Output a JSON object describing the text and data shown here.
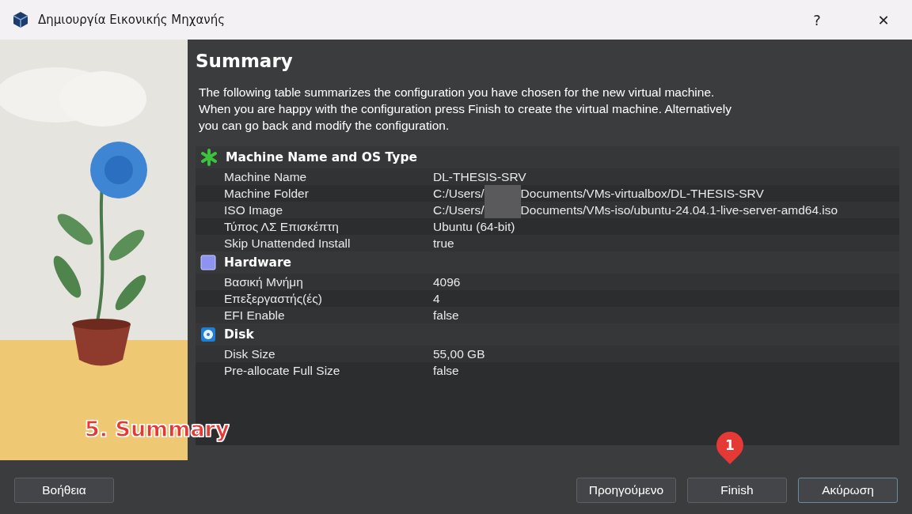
{
  "window": {
    "title": "Δημιουργία Εικονικής Μηχανής",
    "help": "?",
    "close": "✕"
  },
  "page": {
    "title": "Summary",
    "description": "The following table summarizes the configuration you have chosen for the new virtual machine.\nWhen you are happy with the configuration press Finish to create the virtual machine. Alternatively\nyou can go back and modify the configuration."
  },
  "sections": [
    {
      "title": "Machine Name and OS Type",
      "kind": "machine",
      "rows": [
        {
          "label": "Machine Name",
          "value": "DL-THESIS-SRV",
          "kind": "plain"
        },
        {
          "label": "Machine Folder",
          "value": "C:/Users/",
          "value_after": "Documents/VMs-virtualbox/DL-THESIS-SRV",
          "kind": "redacted"
        },
        {
          "label": "ISO Image",
          "value": "C:/Users/",
          "value_after": "Documents/VMs-iso/ubuntu-24.04.1-live-server-amd64.iso",
          "kind": "redacted"
        },
        {
          "label": "Τύπος ΛΣ Επισκέπτη",
          "value": "Ubuntu (64-bit)",
          "kind": "plain"
        },
        {
          "label": "Skip Unattended Install",
          "value": "true",
          "kind": "plain"
        }
      ]
    },
    {
      "title": "Hardware",
      "kind": "hardware",
      "rows": [
        {
          "label": "Βασική Μνήμη",
          "value": "4096",
          "kind": "plain"
        },
        {
          "label": "Επεξεργαστής(ές)",
          "value": "4",
          "kind": "plain"
        },
        {
          "label": "EFI Enable",
          "value": "false",
          "kind": "plain"
        }
      ]
    },
    {
      "title": "Disk",
      "kind": "disk",
      "rows": [
        {
          "label": "Disk Size",
          "value": "55,00 GB",
          "kind": "plain"
        },
        {
          "label": "Pre-allocate Full Size",
          "value": "false",
          "kind": "plain"
        }
      ]
    }
  ],
  "buttons": {
    "help": "Βοήθεια",
    "back": "Προηγούμενο",
    "finish": "Finish",
    "cancel": "Ακύρωση"
  },
  "annotations": {
    "step_label": "5. Summary",
    "marker": "1"
  }
}
